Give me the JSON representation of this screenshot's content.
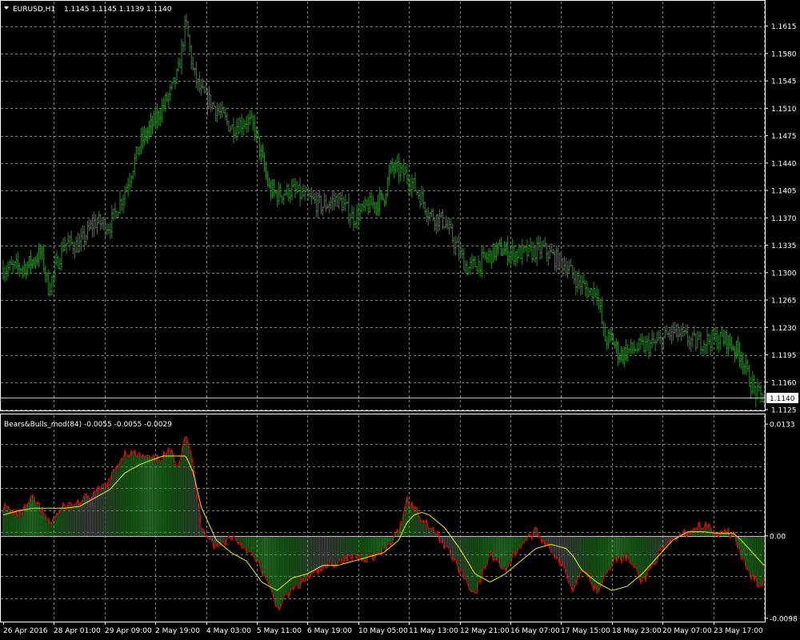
{
  "main_header": {
    "symbol": "EURUSD,H1",
    "ohlc": "1.1145 1.1145 1.1139 1.1140"
  },
  "indicator_header": {
    "label": "Bears&Bulls_mod(84) -0.0055 -0.0055 -0.0029"
  },
  "colors": {
    "background": "#000000",
    "candles": "#2e8b2e",
    "histogram": "#2e8b2e",
    "indicator_line": "#e00000",
    "signal_line": "#f0f000",
    "grid": "#7f7f7f",
    "text": "#ffffff"
  },
  "chart_data": [
    {
      "type": "line",
      "name": "EURUSD,H1",
      "ylim": [
        1.1125,
        1.163
      ],
      "yticks": [
        1.1615,
        1.158,
        1.1545,
        1.151,
        1.1475,
        1.144,
        1.1405,
        1.137,
        1.1335,
        1.13,
        1.1265,
        1.123,
        1.1195,
        1.116,
        1.1125
      ],
      "last_price": 1.114,
      "last_price_label": "1.1140",
      "x_index_max": 100,
      "x": [
        0,
        3,
        5,
        6,
        8,
        10,
        12,
        14,
        16,
        18,
        20,
        22,
        23,
        24,
        25,
        26,
        28,
        30,
        32,
        33,
        35,
        36,
        38,
        40,
        42,
        44,
        46,
        48,
        50,
        51,
        53,
        55,
        56,
        58,
        59,
        61,
        63,
        65,
        67,
        69,
        71,
        73,
        74,
        75,
        77,
        78,
        79,
        80,
        81,
        82,
        84,
        86,
        88,
        90,
        91,
        93,
        95,
        97,
        98,
        99,
        100
      ],
      "y": [
        1.1305,
        1.1308,
        1.1325,
        1.128,
        1.1338,
        1.1335,
        1.1365,
        1.136,
        1.1405,
        1.1465,
        1.1495,
        1.153,
        1.1555,
        1.162,
        1.1555,
        1.153,
        1.151,
        1.1485,
        1.1495,
        1.1485,
        1.1405,
        1.14,
        1.1405,
        1.1395,
        1.1385,
        1.1395,
        1.137,
        1.1385,
        1.1395,
        1.1435,
        1.1425,
        1.1395,
        1.1375,
        1.1365,
        1.1345,
        1.1305,
        1.1315,
        1.133,
        1.1325,
        1.1325,
        1.133,
        1.1315,
        1.131,
        1.1295,
        1.1275,
        1.128,
        1.1215,
        1.1215,
        1.1195,
        1.12,
        1.1205,
        1.121,
        1.1225,
        1.1215,
        1.121,
        1.1215,
        1.1215,
        1.1195,
        1.1165,
        1.1145,
        1.114
      ]
    },
    {
      "type": "area",
      "name": "Bears&Bulls_mod(84)",
      "ylim": [
        -0.01,
        0.0135
      ],
      "yticks": [
        0.0133,
        0.0,
        -0.0098
      ],
      "ytick_labels": [
        "0.0133",
        "0.00",
        "-0.0098"
      ],
      "x_index_max": 100,
      "x": [
        0,
        2,
        4,
        6,
        8,
        10,
        12,
        14,
        15,
        16,
        18,
        20,
        21,
        22,
        23,
        24,
        25,
        26,
        28,
        30,
        32,
        34,
        36,
        38,
        40,
        42,
        44,
        46,
        48,
        50,
        52,
        53,
        54,
        55,
        56,
        58,
        60,
        62,
        64,
        66,
        68,
        70,
        72,
        74,
        75,
        76,
        78,
        80,
        82,
        84,
        86,
        88,
        90,
        92,
        94,
        96,
        97,
        98,
        99,
        100
      ],
      "values": [
        0.0035,
        0.0025,
        0.0045,
        0.0015,
        0.0035,
        0.004,
        0.005,
        0.0065,
        0.0085,
        0.01,
        0.0095,
        0.009,
        0.0095,
        0.01,
        0.0085,
        0.0125,
        0.008,
        0.0015,
        -0.0015,
        0.0,
        -0.0015,
        -0.004,
        -0.0085,
        -0.0065,
        -0.005,
        -0.004,
        -0.003,
        -0.0025,
        -0.0025,
        -0.002,
        0.0005,
        0.0045,
        0.0035,
        0.002,
        0.0015,
        -0.001,
        -0.004,
        -0.007,
        -0.002,
        -0.004,
        -0.001,
        0.0005,
        -0.0015,
        -0.0045,
        -0.0065,
        -0.0035,
        -0.0065,
        -0.003,
        -0.0025,
        -0.0055,
        -0.0025,
        -0.0005,
        0.0005,
        0.0015,
        0.0,
        0.0005,
        -0.0025,
        -0.0045,
        -0.0055,
        -0.0055
      ],
      "signal": [
        0.0025,
        0.003,
        0.0033,
        0.0033,
        0.0033,
        0.0035,
        0.0045,
        0.0055,
        0.0065,
        0.0075,
        0.0085,
        0.0092,
        0.0095,
        0.0095,
        0.0095,
        0.0095,
        0.0075,
        0.0035,
        -0.0005,
        -0.002,
        -0.003,
        -0.0055,
        -0.0065,
        -0.005,
        -0.0045,
        -0.0035,
        -0.0035,
        -0.003,
        -0.0025,
        -0.002,
        -0.0005,
        0.0015,
        0.0025,
        0.0028,
        0.0025,
        0.001,
        -0.0015,
        -0.0045,
        -0.0055,
        -0.0045,
        -0.003,
        -0.0015,
        -0.001,
        -0.0015,
        -0.0025,
        -0.004,
        -0.0055,
        -0.0065,
        -0.006,
        -0.0045,
        -0.0025,
        -0.0005,
        0.0005,
        0.0005,
        0.0003,
        0.0003,
        -0.0005,
        -0.0015,
        -0.0025,
        -0.0035
      ]
    }
  ],
  "x_axis": {
    "labels": [
      "26 Apr 2016",
      "28 Apr 01:00",
      "29 Apr 09:00",
      "2 May 19:00",
      "4 May 03:00",
      "5 May 11:00",
      "6 May 19:00",
      "10 May 05:00",
      "11 May 13:00",
      "12 May 21:00",
      "16 May 07:00",
      "17 May 15:00",
      "18 May 23:00",
      "20 May 07:00",
      "23 May 17:00"
    ]
  }
}
